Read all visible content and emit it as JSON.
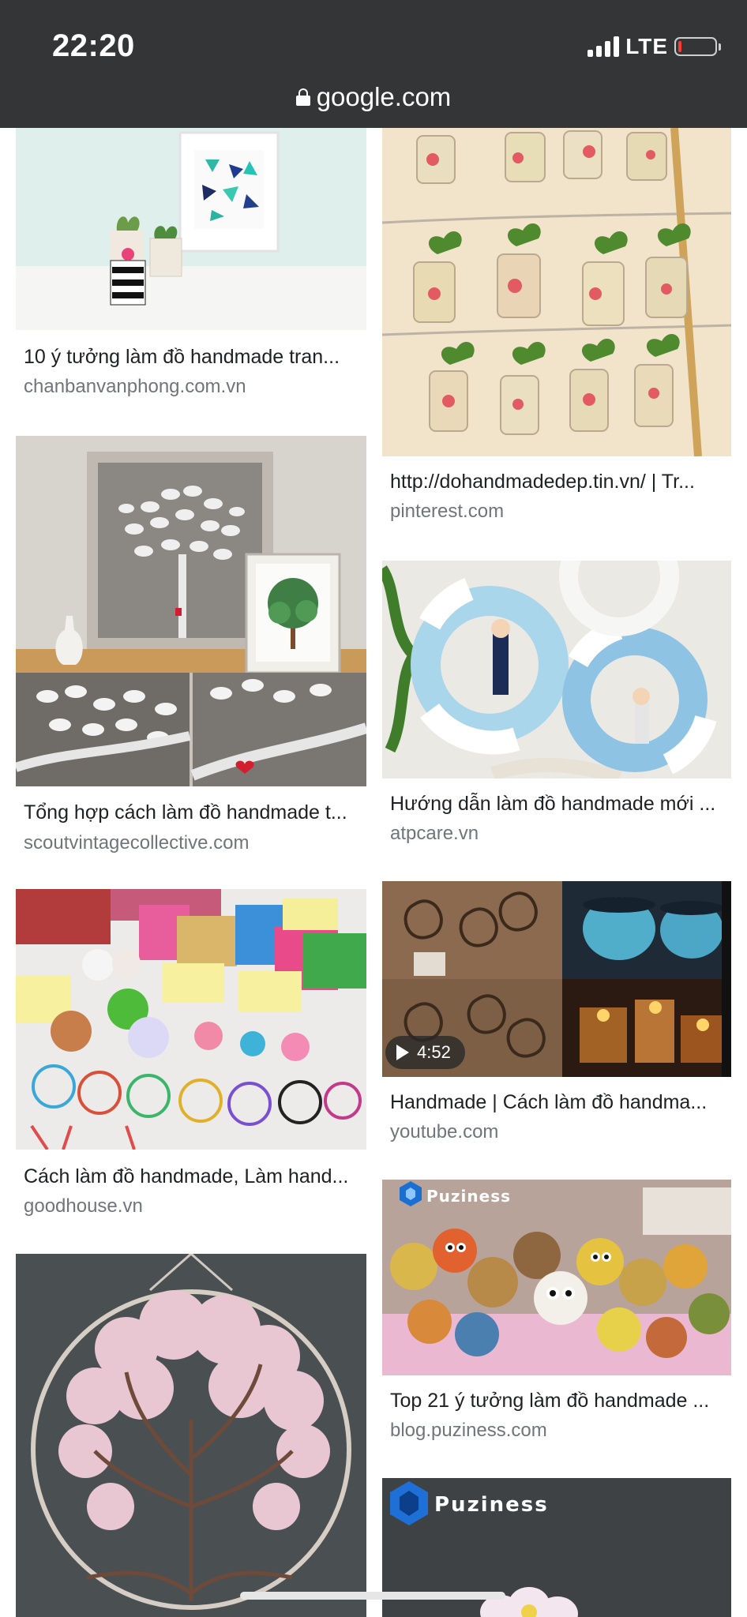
{
  "status_bar": {
    "time": "22:20",
    "network": "LTE",
    "battery_level": 0.1
  },
  "browser": {
    "url": "google.com",
    "lock_icon": "lock-icon"
  },
  "results_left": [
    {
      "caption": "10 ý tưởng làm đồ handmade tran...",
      "source": "chanbanvanphong.com.vn",
      "image_icon": "image-thumbnail"
    },
    {
      "caption": "Tổng hợp cách làm đồ handmade t...",
      "source": "scoutvintagecollective.com",
      "image_icon": "image-thumbnail"
    },
    {
      "caption": "Cách làm đồ handmade, Làm hand...",
      "source": "goodhouse.vn",
      "image_icon": "image-thumbnail"
    },
    {
      "caption": "",
      "source": "",
      "image_icon": "image-thumbnail"
    }
  ],
  "results_right": [
    {
      "caption": "http://dohandmadedep.tin.vn/ | Tr...",
      "source": "pinterest.com",
      "image_icon": "image-thumbnail"
    },
    {
      "caption": "Hướng dẫn làm đồ handmade mới ...",
      "source": "atpcare.vn",
      "image_icon": "image-thumbnail"
    },
    {
      "caption": "Handmade | Cách làm đồ handma...",
      "source": "youtube.com",
      "duration": "4:52",
      "image_icon": "video-thumbnail"
    },
    {
      "caption": "Top 21 ý tưởng làm đồ handmade ...",
      "source": "blog.puziness.com",
      "watermark": "Puziness",
      "image_icon": "image-thumbnail"
    },
    {
      "caption": "",
      "source": "",
      "watermark": "Puziness",
      "image_icon": "image-thumbnail"
    }
  ]
}
